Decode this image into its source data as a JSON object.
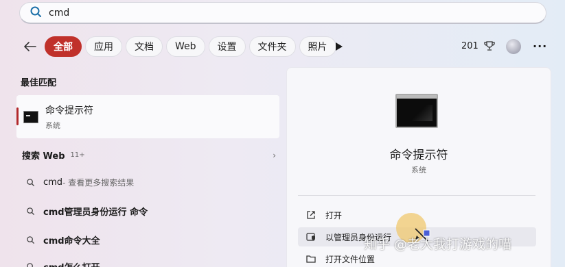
{
  "search": {
    "value": "cmd"
  },
  "filters": {
    "chips": [
      {
        "label": "全部",
        "active": true
      },
      {
        "label": "应用",
        "active": false
      },
      {
        "label": "文档",
        "active": false
      },
      {
        "label": "Web",
        "active": false
      },
      {
        "label": "设置",
        "active": false
      },
      {
        "label": "文件夹",
        "active": false
      },
      {
        "label": "照片",
        "active": false
      }
    ]
  },
  "header": {
    "points": "201"
  },
  "best_match": {
    "section_title": "最佳匹配",
    "title": "命令提示符",
    "subtitle": "系统"
  },
  "web_search": {
    "title": "搜索 Web",
    "count": "11+",
    "items": [
      {
        "query": "cmd",
        "suffix": " - 查看更多搜索结果"
      },
      {
        "query": "cmd管理员身份运行 命令",
        "suffix": ""
      },
      {
        "query": "cmd命令大全",
        "suffix": ""
      },
      {
        "query": "cmd怎么打开",
        "suffix": ""
      }
    ]
  },
  "details": {
    "title": "命令提示符",
    "subtitle": "系统",
    "actions": [
      {
        "label": "打开",
        "icon": "open-external-icon"
      },
      {
        "label": "以管理员身份运行",
        "icon": "shield-icon"
      },
      {
        "label": "打开文件位置",
        "icon": "folder-icon"
      }
    ]
  },
  "watermark": "知乎 @老大我打游戏的喵",
  "colors": {
    "accent": "#c0312b"
  }
}
